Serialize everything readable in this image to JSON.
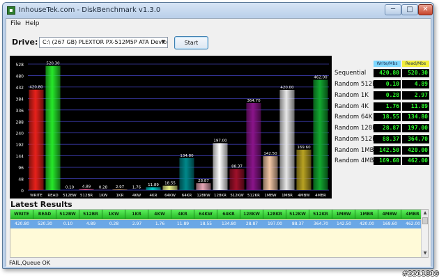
{
  "window": {
    "title": "InhouseTek.com - DiskBenchmark v1.3.0",
    "min_label": "─",
    "max_label": "□",
    "close_label": "✕",
    "app_icon": "app-icon"
  },
  "menu": [
    "File",
    "Help"
  ],
  "drive": {
    "label": "Drive:",
    "selected": "C:\\ (267 GB) PLEXTOR PX-512M5P ATA Device",
    "start_label": "Start"
  },
  "chart_data": {
    "type": "bar",
    "title": "",
    "xlabel": "",
    "ylabel": "",
    "ylim": [
      0,
      528
    ],
    "grid": true,
    "yticks": [
      0,
      48,
      96,
      144,
      192,
      240,
      288,
      336,
      384,
      432,
      480,
      528
    ],
    "categories": [
      "WRITE",
      "READ",
      "512BW",
      "512BR",
      "1KW",
      "1KR",
      "4KW",
      "4KR",
      "64KW",
      "64KR",
      "128KW",
      "128KR",
      "512KW",
      "512KR",
      "1MBW",
      "1MBR",
      "4MBW",
      "4MBR"
    ],
    "values": [
      420.8,
      520.3,
      0.1,
      4.89,
      0.28,
      2.97,
      1.76,
      11.89,
      18.55,
      134.8,
      28.87,
      197.0,
      88.37,
      364.7,
      142.5,
      420.0,
      169.6,
      462.0
    ],
    "labels": [
      "420.80",
      "520.30",
      "0.10",
      "4.89",
      "0.28",
      "2.97",
      "1.76",
      "11.89",
      "18.55",
      "134.80",
      "28.87",
      "197.00",
      "88.37",
      "364.70",
      "142.50",
      "420.00",
      "169.60",
      "462.00"
    ],
    "colors": [
      "#e8211b",
      "#26e82a",
      "#2a35c8",
      "#e35c8e",
      "#5a3d9a",
      "#e5b07d",
      "#2a35c8",
      "#00c5c5",
      "#e8f088",
      "#00888a",
      "#e6a6b6",
      "#ffffff",
      "#a0102a",
      "#8a148a",
      "#f4c7a6",
      "#e8e8e8",
      "#b8a222",
      "#12a830"
    ]
  },
  "results": {
    "write_header": "Write/Mbs",
    "read_header": "Read/Mbs",
    "rows": [
      {
        "label": "Sequential",
        "write": "420.80",
        "read": "520.30"
      },
      {
        "label": "Random 512B",
        "write": "0.10",
        "read": "4.89"
      },
      {
        "label": "Random 1K",
        "write": "0.28",
        "read": "2.97"
      },
      {
        "label": "Random 4K",
        "write": "1.76",
        "read": "11.89"
      },
      {
        "label": "Random 64K",
        "write": "18.55",
        "read": "134.80"
      },
      {
        "label": "Random 128K",
        "write": "28.87",
        "read": "197.00"
      },
      {
        "label": "Random 512K",
        "write": "88.37",
        "read": "364.70"
      },
      {
        "label": "Random 1MB",
        "write": "142.50",
        "read": "420.00"
      },
      {
        "label": "Random 4MB",
        "write": "169.60",
        "read": "462.00"
      }
    ]
  },
  "latest": {
    "title": "Latest Results",
    "headers": [
      "WRITE",
      "READ",
      "512BW",
      "512BR",
      "1KW",
      "1KR",
      "4KW",
      "4KR",
      "64KW",
      "64KR",
      "128KW",
      "128KR",
      "512KW",
      "512KR",
      "1MBW",
      "1MBR",
      "4MBW",
      "4MBR"
    ],
    "row": [
      "420.80",
      "520.30",
      "0.10",
      "4.89",
      "0.28",
      "2.97",
      "1.76",
      "11.89",
      "18.55",
      "134.80",
      "28.87",
      "197.00",
      "88.37",
      "364.70",
      "142.50",
      "420.00",
      "169.60",
      "462.00"
    ],
    "scroll_up": "▲",
    "scroll_down": "▼"
  },
  "status": "FAIL,Queue OK",
  "watermark": "#2211819"
}
